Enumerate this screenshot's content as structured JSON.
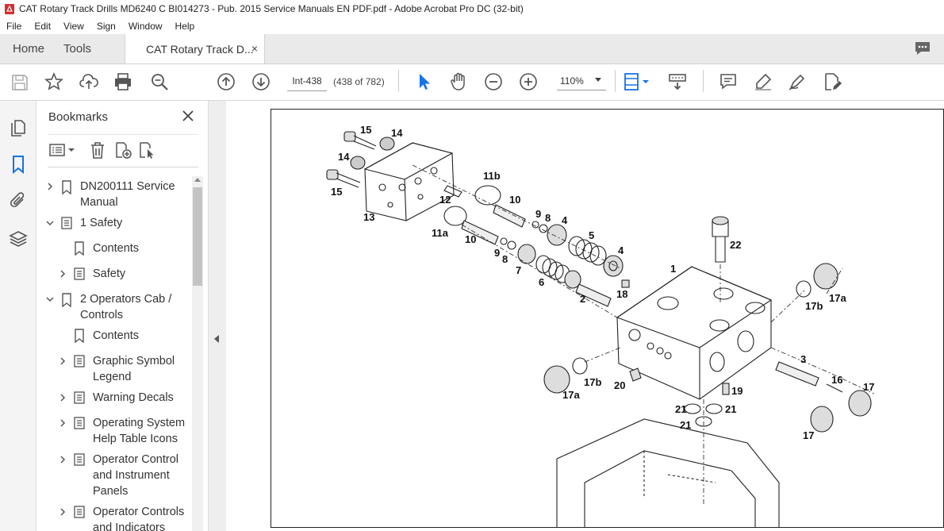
{
  "window": {
    "title": "CAT Rotary Track Drills MD6240 C BI014273 - Pub. 2015 Service Manuals EN PDF.pdf - Adobe Acrobat Pro DC (32-bit)"
  },
  "menu": [
    "File",
    "Edit",
    "View",
    "Sign",
    "Window",
    "Help"
  ],
  "tabs": {
    "home": "Home",
    "tools": "Tools",
    "document": "CAT Rotary Track D...",
    "close_glyph": "×"
  },
  "toolbar": {
    "page_label": "Int-438",
    "page_of": "(438 of 782)",
    "zoom": "110%"
  },
  "bookmarks": {
    "title": "Bookmarks",
    "close_glyph": "×",
    "items": [
      {
        "line1": "DN200111 Service",
        "line2": "Manual"
      },
      {
        "line1": "1 Safety"
      },
      {
        "line1": "Contents"
      },
      {
        "line1": "Safety"
      },
      {
        "line1": "2 Operators Cab /",
        "line2": "Controls"
      },
      {
        "line1": "Contents"
      },
      {
        "line1": "Graphic Symbol",
        "line2": "Legend"
      },
      {
        "line1": "Warning Decals"
      },
      {
        "line1": "Operating System",
        "line2": "Help Table Icons"
      },
      {
        "line1": "Operator Control",
        "line2": "and Instrument",
        "line3": "Panels"
      },
      {
        "line1": "Operator Controls",
        "line2": "and Indicators"
      }
    ]
  },
  "diagram": {
    "callouts": [
      "15",
      "14",
      "14",
      "15",
      "13",
      "12",
      "11b",
      "10",
      "11a",
      "10",
      "9",
      "8",
      "4",
      "5",
      "9",
      "8",
      "7",
      "6",
      "4",
      "22",
      "1",
      "2",
      "18",
      "17a",
      "17b",
      "3",
      "16",
      "17",
      "20",
      "17b",
      "17a",
      "19",
      "21",
      "21",
      "21",
      "17"
    ]
  },
  "colors": {
    "accent": "#1473e6",
    "pdf_red": "#d32f2f"
  }
}
